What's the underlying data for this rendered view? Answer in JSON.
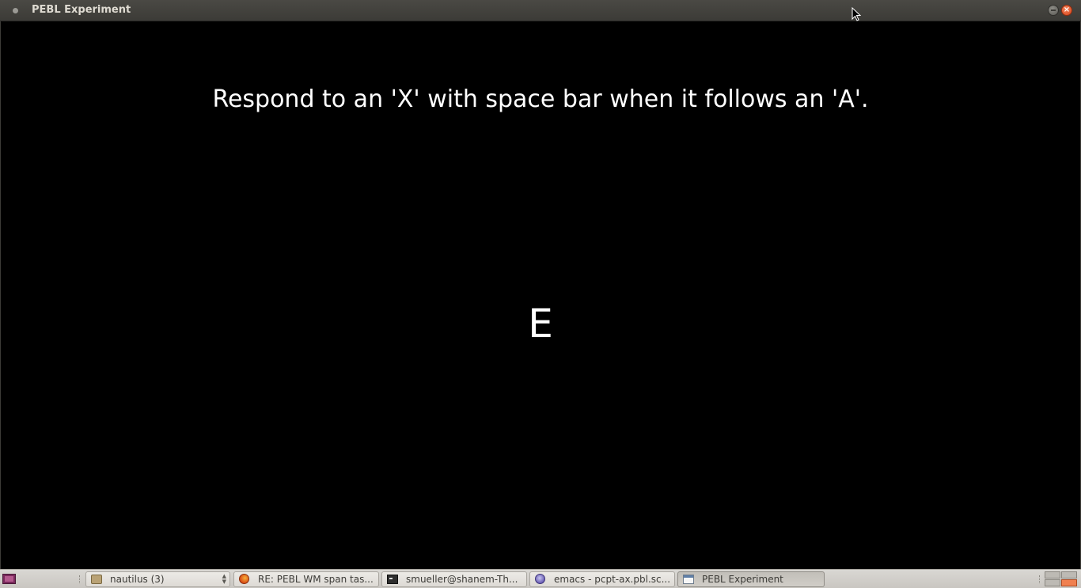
{
  "window": {
    "title": "PEBL Experiment",
    "close_glyph": "×"
  },
  "experiment": {
    "instruction": "Respond to an 'X' with space bar when it follows an 'A'.",
    "stimulus": "E"
  },
  "taskbar": {
    "show_desktop_icon": "show-desktop-icon",
    "items": [
      {
        "label": "nautilus (3)",
        "icon": "file-cabinet-icon",
        "grouped": true
      },
      {
        "label": "RE: PEBL WM span tas...",
        "icon": "firefox-icon"
      },
      {
        "label": "smueller@shanem-Th...",
        "icon": "terminal-icon"
      },
      {
        "label": "emacs - pcpt-ax.pbl.sc...",
        "icon": "emacs-icon"
      },
      {
        "label": "PEBL Experiment",
        "icon": "window-icon",
        "active": true
      }
    ],
    "workspaces": 4,
    "active_workspace": 4
  },
  "colors": {
    "background": "#000000",
    "text": "#ffffff",
    "titlebar": "#3c3b37",
    "close_button": "#e05a2b",
    "active_workspace": "#f08050"
  }
}
